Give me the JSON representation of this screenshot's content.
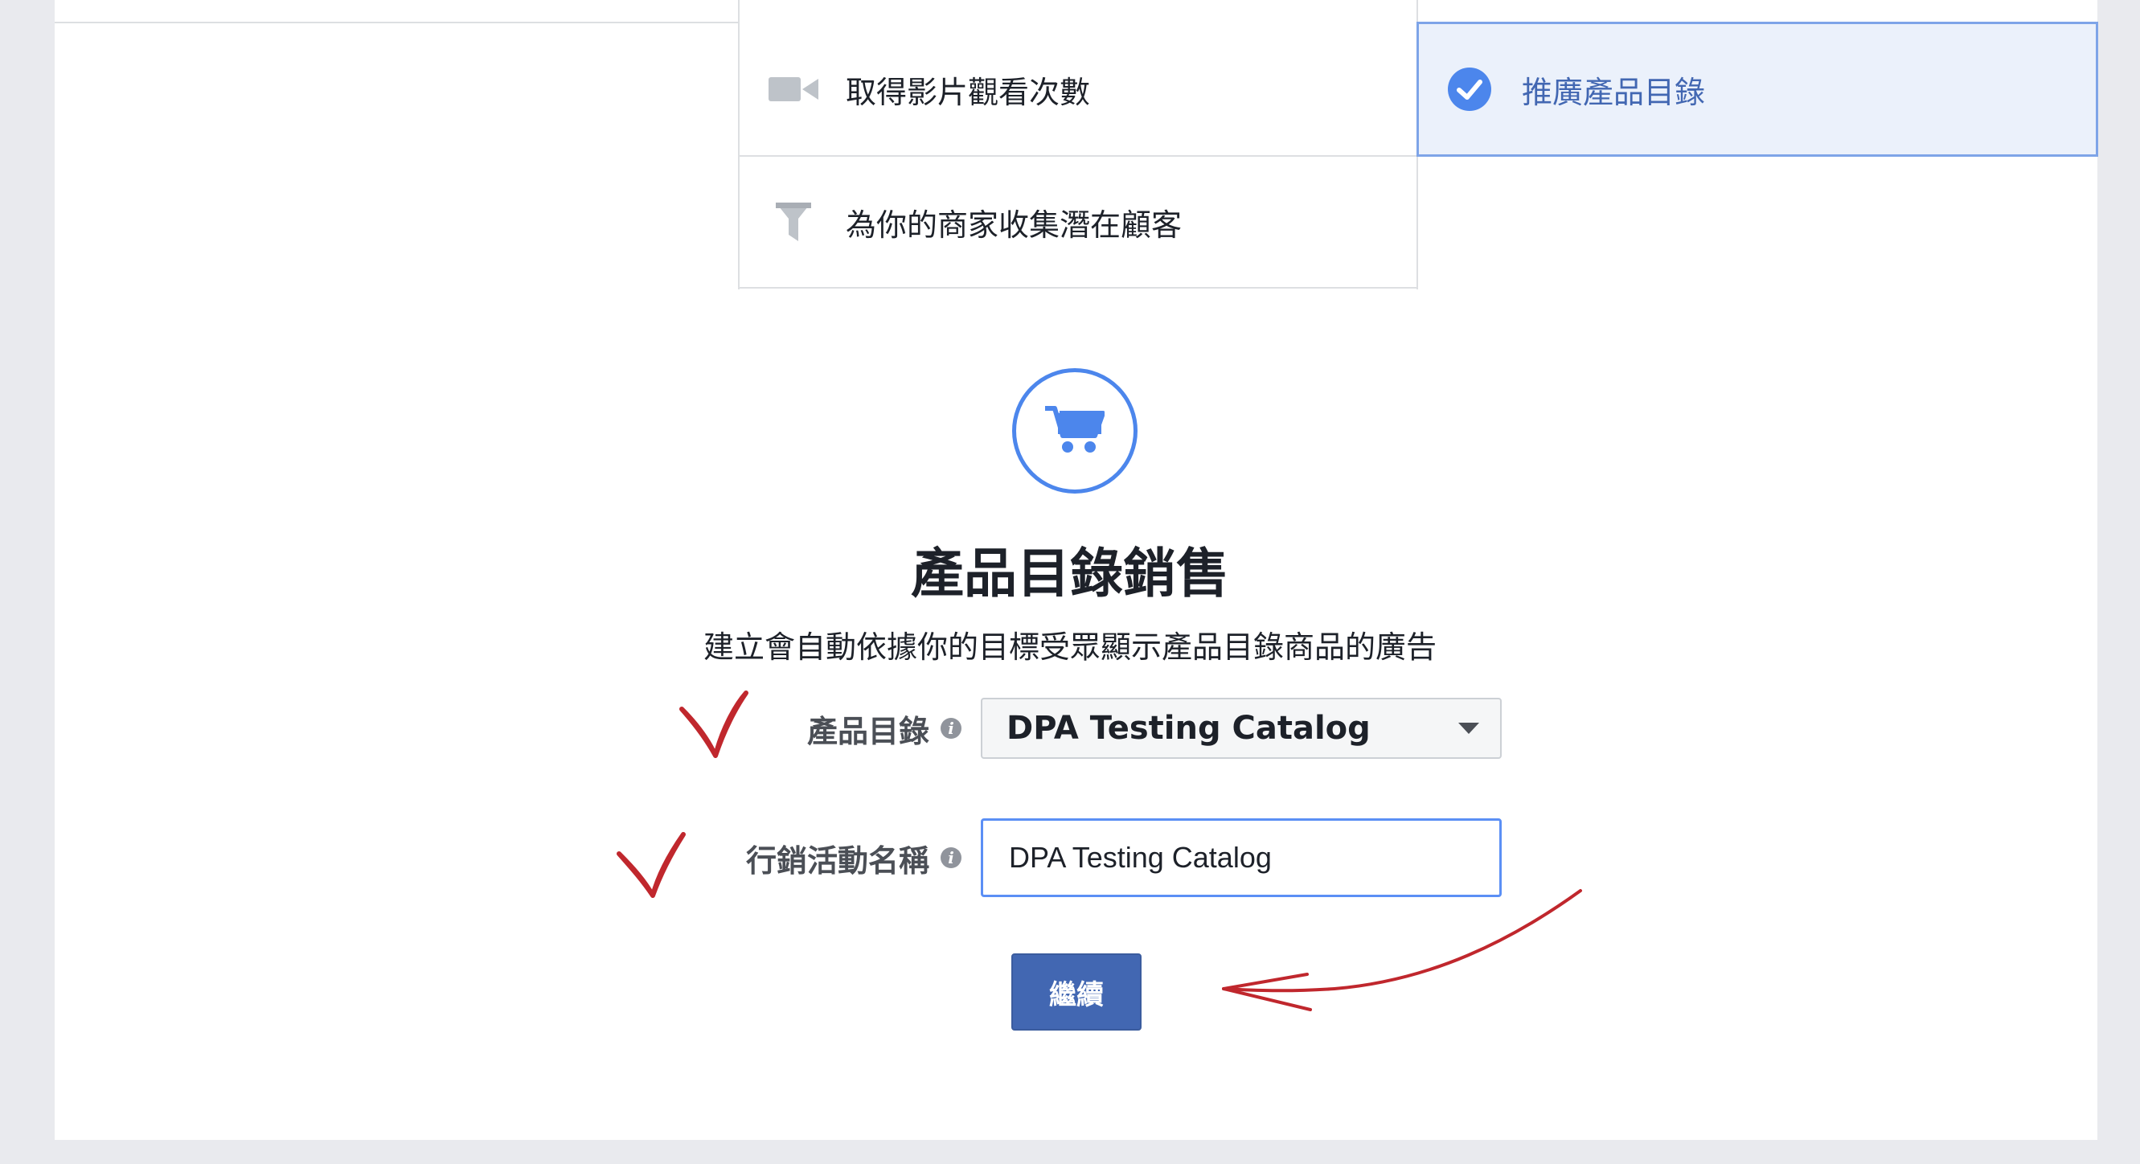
{
  "objectives": {
    "video_views": {
      "label": "取得影片觀看次數",
      "icon": "video-camera-icon"
    },
    "lead_generation": {
      "label": "為你的商家收集潛在顧客",
      "icon": "funnel-icon"
    },
    "catalog_sales": {
      "label": "推廣產品目錄",
      "icon": "check-circle-icon",
      "selected": true
    }
  },
  "main": {
    "hero_icon": "shopping-cart-icon",
    "title": "產品目錄銷售",
    "subtitle": "建立會自動依據你的目標受眾顯示產品目錄商品的廣告"
  },
  "form": {
    "catalog_label": "產品目錄",
    "catalog_value": "DPA Testing Catalog",
    "campaign_label": "行銷活動名稱",
    "campaign_value": "DPA Testing Catalog",
    "continue_label": "繼續"
  },
  "colors": {
    "accent": "#4267b2",
    "selected_bg": "#ebf1fb",
    "annotation": "#c0272d",
    "page_bg": "#e9eaee"
  }
}
